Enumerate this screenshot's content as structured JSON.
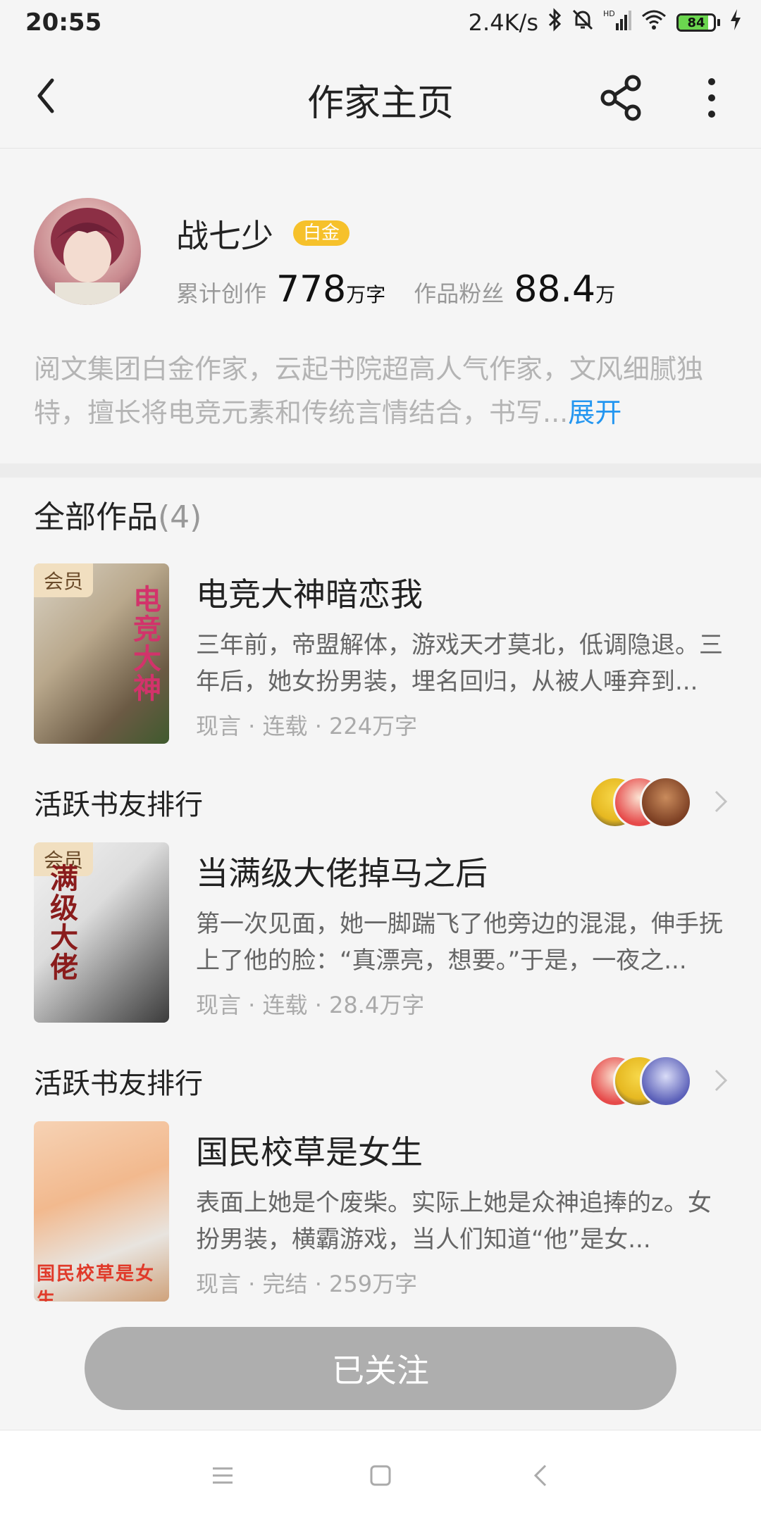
{
  "status_bar": {
    "time": "20:55",
    "net_speed": "2.4K/s",
    "battery": "84",
    "battery_level": 0.84,
    "icons": [
      "bluetooth-icon",
      "mute-icon",
      "signal-icon",
      "wifi-icon",
      "battery-icon",
      "charging-icon"
    ]
  },
  "nav": {
    "title": "作家主页",
    "back_icon": "back-icon",
    "share_icon": "share-icon",
    "more_icon": "more-icon"
  },
  "author": {
    "name": "战七少",
    "badge": "白金",
    "stats": [
      {
        "label": "累计创作",
        "value": "778",
        "unit": "万字"
      },
      {
        "label": "作品粉丝",
        "value": "88.4",
        "unit": "万"
      }
    ],
    "bio": "阅文集团白金作家，云起书院超高人气作家，文风细腻独特，擅长将电竞元素和传统言情结合，书写...",
    "expand": "展开"
  },
  "works": {
    "header": "全部作品",
    "count": "(4)",
    "books": [
      {
        "title": "电竞大神暗恋我",
        "cover_title": "电竞大神",
        "vip": "会员",
        "desc": "三年前，帝盟解体，游戏天才莫北，低调隐退。三年后，她女扮男装，埋名回归，从被人唾弃到...",
        "meta": "现言 · 连载 · 224万字"
      },
      {
        "title": "当满级大佬掉马之后",
        "cover_title": "满级大佬",
        "vip": "会员",
        "desc": "第一次见面，她一脚踹飞了他旁边的混混，伸手抚上了他的脸：“真漂亮，想要。”于是，一夜之...",
        "meta": "现言 · 连载 · 28.4万字"
      },
      {
        "title": "国民校草是女生",
        "cover_title": "国民校草是女生",
        "vip": "",
        "desc": "表面上她是个废柴。实际上她是众神追捧的z。女扮男装，横霸游戏，当人们知道“他”是女...",
        "meta": "现言 · 完结 · 259万字"
      }
    ],
    "rank_label": "活跃书友排行"
  },
  "follow_button": "已关注",
  "sysnav": [
    "menu-icon",
    "home-icon",
    "back-icon"
  ],
  "colors": {
    "accent": "#2396f0",
    "badge": "#f6c12b",
    "follow_bg": "#aeaeae"
  }
}
